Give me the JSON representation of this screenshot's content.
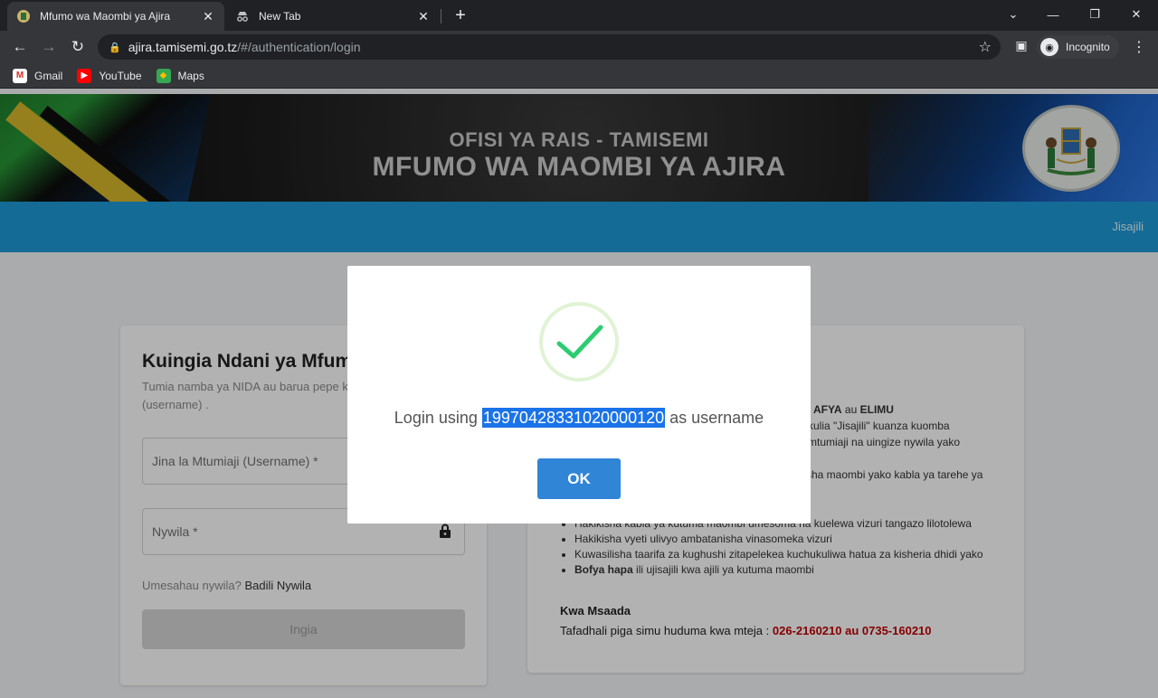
{
  "browser": {
    "tabs": [
      {
        "title": "Mfumo wa Maombi ya Ajira",
        "favicon": "emblem-icon",
        "active": true
      },
      {
        "title": "New Tab",
        "favicon": "incognito-icon",
        "active": false
      }
    ],
    "url": {
      "host": "ajira.tamisemi.go.tz",
      "path": "/#/authentication/login"
    },
    "incognito_label": "Incognito",
    "bookmarks": [
      {
        "label": "Gmail",
        "icon": "gmail-icon"
      },
      {
        "label": "YouTube",
        "icon": "youtube-icon"
      },
      {
        "label": "Maps",
        "icon": "maps-icon"
      }
    ]
  },
  "header": {
    "subtitle": "OFISI YA RAIS - TAMISEMI",
    "title": "MFUMO WA MAOMBI YA AJIRA"
  },
  "nav": {
    "register_link": "Jisajili"
  },
  "login": {
    "heading": "Kuingia Ndani ya Mfumo",
    "instruction": "Tumia namba ya NIDA au barua pepe kama jina la mtumiaji (username) .",
    "username_label": "Jina la Mtumiaji (Username) *",
    "password_label": "Nywila *",
    "forgot_text": "Umesahau nywila?",
    "forgot_link": "Badili Nywila",
    "submit_label": "Ingia"
  },
  "info": {
    "line1_bold_a": "AFYA",
    "line1_mid": "au",
    "line1_bold_b": "ELIMU",
    "line2": "u kulia \"Jisajili\" kuanza kuomba",
    "line3": "a mtumiaji na uingize nywila yako",
    "line4": "ilisha maombi yako kabla ya tarehe ya",
    "bullets": [
      "Hakikisha kabla ya kutuma maombi umesoma na kuelewa vizuri tangazo lilotolewa",
      "Hakikisha vyeti ulivyo ambatanisha vinasomeka vizuri",
      "Kuwasilisha taarifa za kughushi zitapelekea kuchukuliwa hatua za kisheria dhidi yako"
    ],
    "bullet_last_bold": "Bofya hapa",
    "bullet_last_rest": "ili ujisajili kwa ajili ya kutuma maombi",
    "help_title": "Kwa Msaada",
    "help_text": "Tafadhali piga simu huduma kwa mteja :",
    "help_phones": "026-2160210 au 0735-160210"
  },
  "modal": {
    "msg_before": "Login using",
    "username_value": "19970428331020000120",
    "msg_after": "as username",
    "ok_label": "OK",
    "accent": "#3085d6",
    "check_color": "#2ecc71"
  }
}
